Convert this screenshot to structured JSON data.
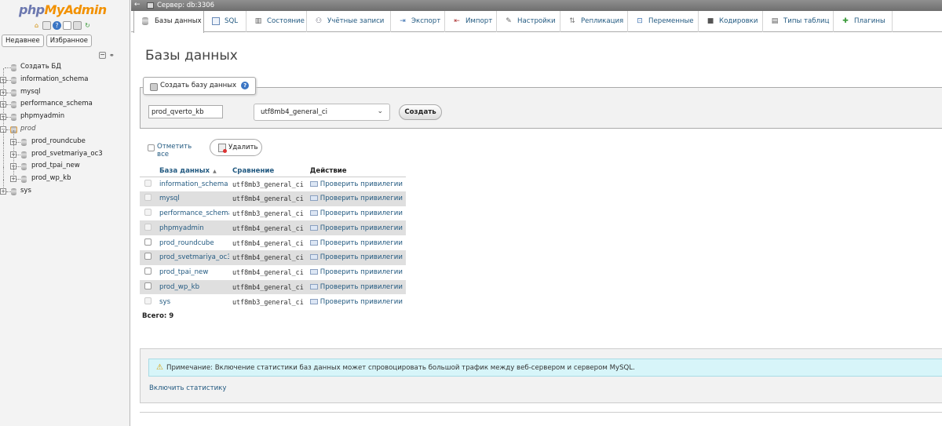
{
  "navigation": {
    "logo_part1": "php",
    "logo_part2": "MyAdmin",
    "tabs": [
      "Недавнее",
      "Избранное"
    ],
    "tree": [
      {
        "label": "Создать БД",
        "kind": "new"
      },
      {
        "label": "information_schema",
        "kind": "db"
      },
      {
        "label": "mysql",
        "kind": "db"
      },
      {
        "label": "performance_schema",
        "kind": "db"
      },
      {
        "label": "phpmyadmin",
        "kind": "db"
      },
      {
        "label": "prod",
        "kind": "group"
      },
      {
        "label": "prod_roundcube",
        "kind": "sub"
      },
      {
        "label": "prod_svetmariya_oc3",
        "kind": "sub"
      },
      {
        "label": "prod_tpai_new",
        "kind": "sub"
      },
      {
        "label": "prod_wp_kb",
        "kind": "sub"
      },
      {
        "label": "sys",
        "kind": "db"
      }
    ]
  },
  "topbar": {
    "server": "Сервер: db:3306"
  },
  "menu": {
    "tabs": [
      {
        "label": "Базы данных",
        "icon": "database-icon",
        "active": true
      },
      {
        "label": "SQL",
        "icon": "sql-icon",
        "active": false
      },
      {
        "label": "Состояние",
        "icon": "status-chart-icon",
        "active": false
      },
      {
        "label": "Учётные записи",
        "icon": "users-icon",
        "active": false
      },
      {
        "label": "Экспорт",
        "icon": "export-icon",
        "active": false
      },
      {
        "label": "Импорт",
        "icon": "import-icon",
        "active": false
      },
      {
        "label": "Настройки",
        "icon": "wrench-icon",
        "active": false
      },
      {
        "label": "Репликация",
        "icon": "replication-icon",
        "active": false
      },
      {
        "label": "Переменные",
        "icon": "variables-icon",
        "active": false
      },
      {
        "label": "Кодировки",
        "icon": "charset-icon",
        "active": false
      },
      {
        "label": "Типы таблиц",
        "icon": "engines-icon",
        "active": false
      },
      {
        "label": "Плагины",
        "icon": "plugin-icon",
        "active": false
      }
    ]
  },
  "main": {
    "title": "Базы данных",
    "create": {
      "legend": "Создать базу данных",
      "db_name_value": "prod_qverto_kb",
      "collation": "utf8mb4_general_ci",
      "button": "Создать"
    },
    "select_all": "Отметить все",
    "drop_button": "Удалить",
    "table": {
      "headers": [
        "База данных",
        "Сравнение",
        "Действие"
      ],
      "rows": [
        {
          "name": "information_schema",
          "collation": "utf8mb3_general_ci",
          "action": "Проверить привилегии",
          "checkable": false
        },
        {
          "name": "mysql",
          "collation": "utf8mb4_general_ci",
          "action": "Проверить привилегии",
          "checkable": false
        },
        {
          "name": "performance_schema",
          "collation": "utf8mb3_general_ci",
          "action": "Проверить привилегии",
          "checkable": false
        },
        {
          "name": "phpmyadmin",
          "collation": "utf8mb4_general_ci",
          "action": "Проверить привилегии",
          "checkable": false
        },
        {
          "name": "prod_roundcube",
          "collation": "utf8mb4_general_ci",
          "action": "Проверить привилегии",
          "checkable": true
        },
        {
          "name": "prod_svetmariya_oc3",
          "collation": "utf8mb4_general_ci",
          "action": "Проверить привилегии",
          "checkable": true
        },
        {
          "name": "prod_tpai_new",
          "collation": "utf8mb4_general_ci",
          "action": "Проверить привилегии",
          "checkable": true
        },
        {
          "name": "prod_wp_kb",
          "collation": "utf8mb4_general_ci",
          "action": "Проверить привилегии",
          "checkable": true
        },
        {
          "name": "sys",
          "collation": "utf8mb3_general_ci",
          "action": "Проверить привилегии",
          "checkable": false
        }
      ]
    },
    "total": "Всего: 9",
    "notice": "Примечание: Включение статистики баз данных может спровоцировать большой трафик между веб-сервером и сервером MySQL.",
    "enable_stats": "Включить статистику"
  }
}
